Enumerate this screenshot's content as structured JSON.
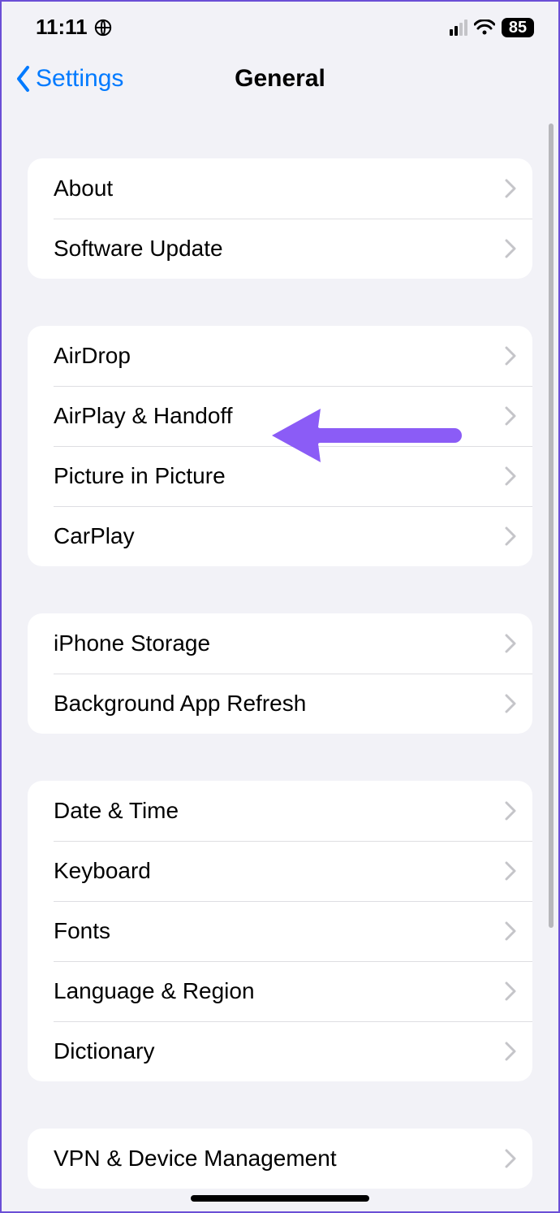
{
  "status": {
    "time": "11:11",
    "battery": "85"
  },
  "nav": {
    "back_label": "Settings",
    "title": "General"
  },
  "groups": [
    {
      "rows": [
        {
          "label": "About",
          "name": "row-about"
        },
        {
          "label": "Software Update",
          "name": "row-software-update"
        }
      ]
    },
    {
      "rows": [
        {
          "label": "AirDrop",
          "name": "row-airdrop"
        },
        {
          "label": "AirPlay & Handoff",
          "name": "row-airplay-handoff"
        },
        {
          "label": "Picture in Picture",
          "name": "row-picture-in-picture"
        },
        {
          "label": "CarPlay",
          "name": "row-carplay"
        }
      ]
    },
    {
      "rows": [
        {
          "label": "iPhone Storage",
          "name": "row-iphone-storage"
        },
        {
          "label": "Background App Refresh",
          "name": "row-background-app-refresh"
        }
      ]
    },
    {
      "rows": [
        {
          "label": "Date & Time",
          "name": "row-date-time"
        },
        {
          "label": "Keyboard",
          "name": "row-keyboard"
        },
        {
          "label": "Fonts",
          "name": "row-fonts"
        },
        {
          "label": "Language & Region",
          "name": "row-language-region"
        },
        {
          "label": "Dictionary",
          "name": "row-dictionary"
        }
      ]
    },
    {
      "rows": [
        {
          "label": "VPN & Device Management",
          "name": "row-vpn-device-management"
        }
      ]
    }
  ],
  "annotation": {
    "arrow_color": "#8b5cf6"
  }
}
